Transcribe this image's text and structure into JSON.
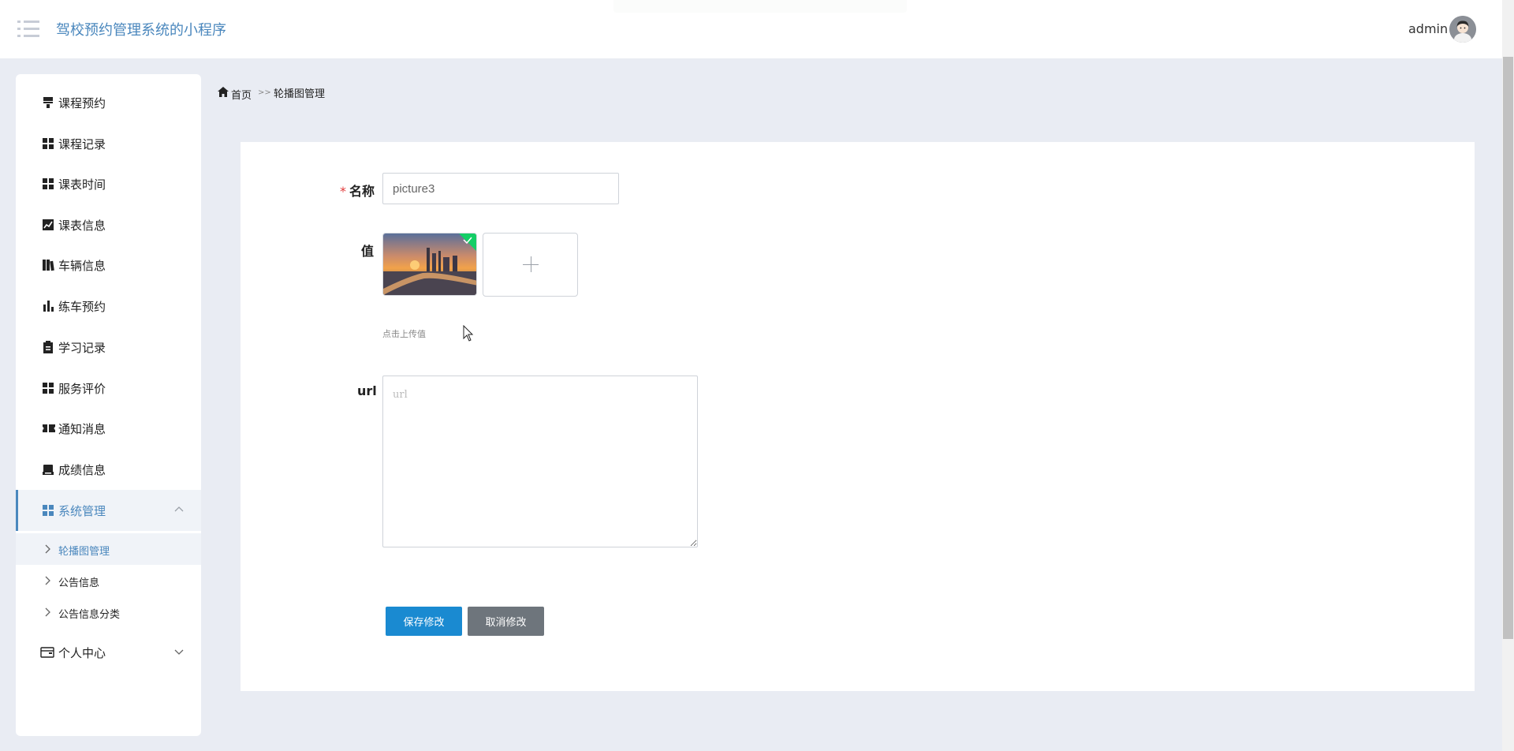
{
  "app": {
    "title": "驾校预约管理系统的小程序",
    "user": "admin"
  },
  "colors": {
    "accent": "#4a87bd",
    "primary_button": "#1a8ad1",
    "secondary_button": "#6e757c",
    "page_bg": "#e9ecf3",
    "required": "#e23b3b"
  },
  "sidebar": {
    "items": [
      {
        "label": "课程预约",
        "icon": "menu-icon"
      },
      {
        "label": "课程记录",
        "icon": "grid-icon"
      },
      {
        "label": "课表时间",
        "icon": "grid-icon"
      },
      {
        "label": "课表信息",
        "icon": "line-chart-icon"
      },
      {
        "label": "车辆信息",
        "icon": "book-icon"
      },
      {
        "label": "练车预约",
        "icon": "bar-chart-icon"
      },
      {
        "label": "学习记录",
        "icon": "clipboard-icon"
      },
      {
        "label": "服务评价",
        "icon": "grid-icon"
      },
      {
        "label": "通知消息",
        "icon": "ticket-icon"
      },
      {
        "label": "成绩信息",
        "icon": "inbox-icon"
      },
      {
        "label": "系统管理",
        "icon": "grid-icon",
        "expanded": true
      },
      {
        "label": "个人中心",
        "icon": "wallet-icon",
        "expanded": false
      }
    ],
    "sub_items": [
      {
        "label": "轮播图管理",
        "active": true
      },
      {
        "label": "公告信息",
        "active": false
      },
      {
        "label": "公告信息分类",
        "active": false
      }
    ]
  },
  "breadcrumb": {
    "home": "首页",
    "separator": ">>",
    "current": "轮播图管理"
  },
  "form": {
    "name_label": "名称",
    "required_mark": "*",
    "name_value": "picture3",
    "value_label": "值",
    "upload_tip": "点击上传值",
    "url_label": "url",
    "url_placeholder": "url",
    "save_label": "保存修改",
    "cancel_label": "取消修改"
  }
}
